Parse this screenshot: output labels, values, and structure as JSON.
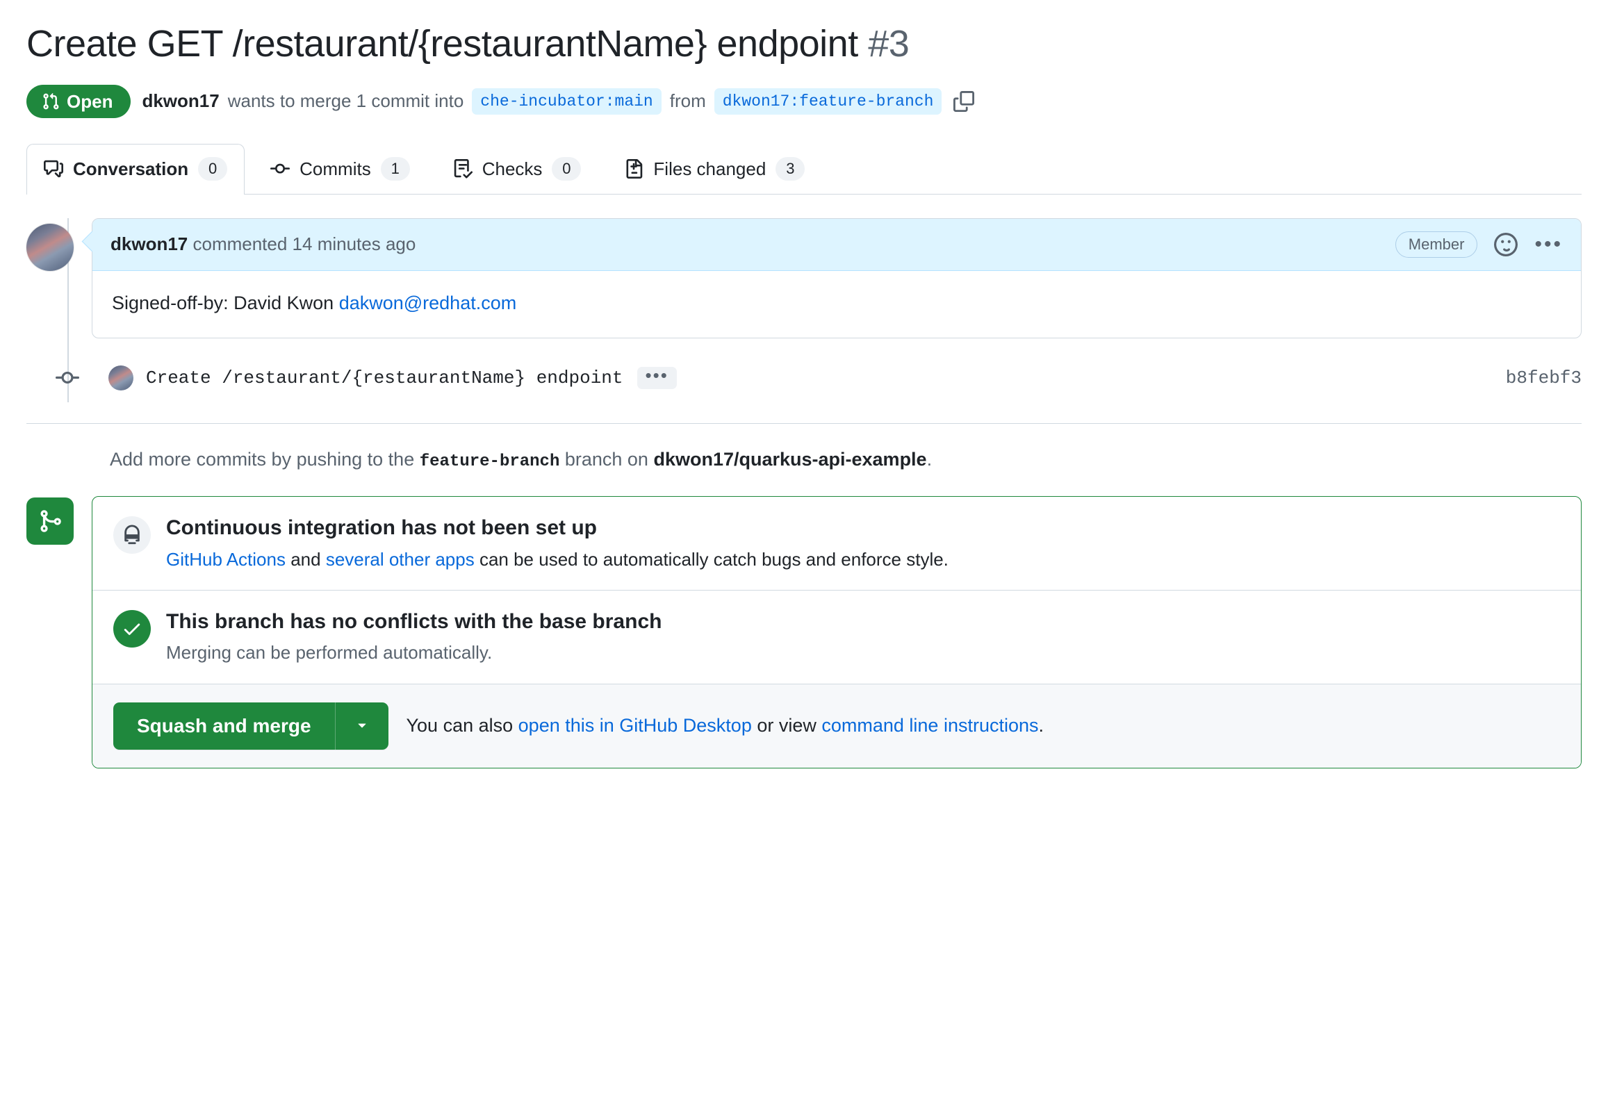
{
  "pr": {
    "title": "Create GET /restaurant/{restaurantName} endpoint",
    "number": "#3",
    "state": "Open",
    "author": "dkwon17",
    "merge_sentence_1": "wants to merge 1 commit into",
    "base_branch": "che-incubator:main",
    "merge_sentence_2": "from",
    "head_branch": "dkwon17:feature-branch",
    "copy_icon": "copy-icon",
    "state_icon": "git-pull-request-icon"
  },
  "tabs": [
    {
      "label": "Conversation",
      "count": "0",
      "icon": "comment-discussion-icon",
      "active": true
    },
    {
      "label": "Commits",
      "count": "1",
      "icon": "git-commit-icon",
      "active": false
    },
    {
      "label": "Checks",
      "count": "0",
      "icon": "checklist-icon",
      "active": false
    },
    {
      "label": "Files changed",
      "count": "3",
      "icon": "file-diff-icon",
      "active": false
    }
  ],
  "comment": {
    "author": "dkwon17",
    "meta": "commented 14 minutes ago",
    "badge": "Member",
    "reaction_icon": "smiley-icon",
    "menu_icon": "kebab-horizontal-icon",
    "body_prefix": "Signed-off-by: David Kwon ",
    "body_link": "dakwon@redhat.com"
  },
  "commit": {
    "message": "Create /restaurant/{restaurantName} endpoint",
    "ellipsis": "•••",
    "hash": "b8febf3",
    "node_icon": "git-commit-node-icon"
  },
  "add_commits": {
    "prefix": "Add more commits by pushing to the ",
    "branch": "feature-branch",
    "middle": " branch on ",
    "repo": "dkwon17/quarkus-api-example",
    "suffix": "."
  },
  "merge_box": {
    "badge_icon": "git-merge-icon",
    "ci": {
      "icon": "hubot-icon",
      "heading": "Continuous integration has not been set up",
      "link_1": "GitHub Actions",
      "middle_1": " and ",
      "link_2": "several other apps",
      "tail": " can be used to automatically catch bugs and enforce style."
    },
    "conflicts": {
      "icon": "check-icon",
      "heading": "This branch has no conflicts with the base branch",
      "sub": "Merging can be performed automatically."
    },
    "footer": {
      "merge_button": "Squash and merge",
      "caret_icon": "triangle-down-icon",
      "text_prefix": "You can also ",
      "link_1": "open this in GitHub Desktop",
      "middle": " or view ",
      "link_2": "command line instructions",
      "suffix": "."
    }
  },
  "colors": {
    "open_green": "#1f883d",
    "link_blue": "#0969da",
    "branch_bg": "#ddf4ff",
    "comment_header_bg": "#ddf4ff",
    "border": "#d1d9e0",
    "muted_text": "#59636e",
    "footer_bg": "#f6f8fa"
  }
}
